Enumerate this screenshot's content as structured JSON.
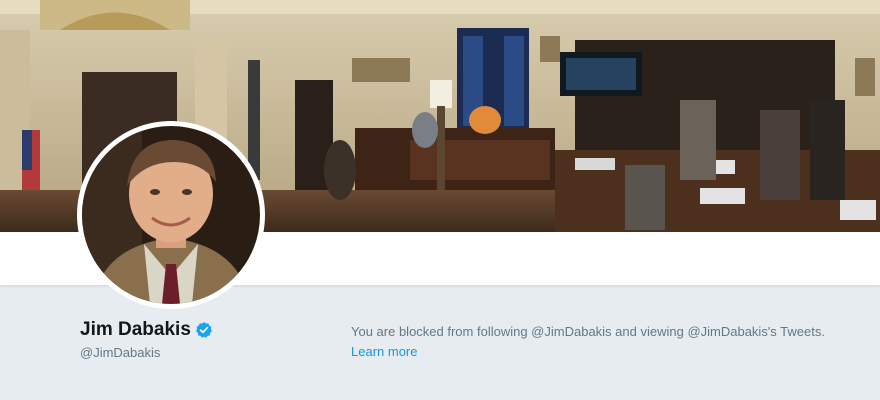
{
  "profile": {
    "display_name": "Jim Dabakis",
    "handle": "@JimDabakis",
    "verified": true,
    "header_image": "legislative-chamber-photo",
    "avatar_image": "profile-portrait-photo"
  },
  "blocked_notice": {
    "text": "You are blocked from following @JimDabakis and viewing @JimDabakis's Tweets.",
    "link_label": "Learn more"
  },
  "colors": {
    "page_background": "#e6ecf0",
    "link": "#1b95e0",
    "verified_badge": "#1da1f2",
    "secondary_text": "#657786",
    "primary_text": "#14171a"
  },
  "icons": {
    "verified": "verified-badge-icon"
  }
}
